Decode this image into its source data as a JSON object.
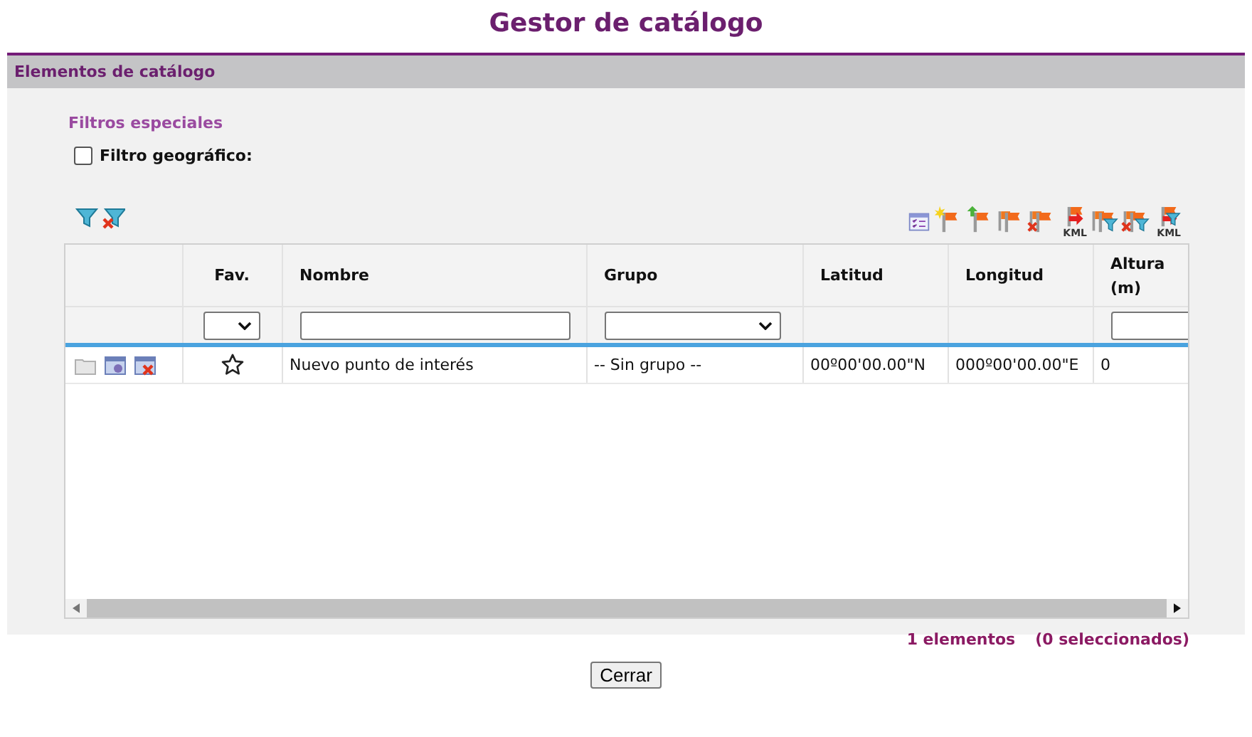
{
  "title": "Gestor de catálogo",
  "panel": {
    "title": "Elementos de catálogo"
  },
  "special_filters": {
    "title": "Filtros especiales",
    "geo_filter": {
      "label": "Filtro geográfico:",
      "checked": false
    }
  },
  "filter_tools": [
    {
      "kind": "filter"
    },
    {
      "kind": "filter-clear"
    }
  ],
  "toolbar": [
    {
      "kind": "checklist"
    },
    {
      "kind": "flag-new"
    },
    {
      "kind": "flag-arrow"
    },
    {
      "kind": "flags"
    },
    {
      "kind": "flags-delete"
    },
    {
      "kind": "flag-kml",
      "label": "KML"
    },
    {
      "kind": "flags-filter"
    },
    {
      "kind": "flags-delete-filter"
    },
    {
      "kind": "flag-kml-filter",
      "label": "KML"
    }
  ],
  "table": {
    "columns": [
      {
        "kind": "none"
      },
      {
        "label": "Fav.",
        "kind": "select"
      },
      {
        "label": "Nombre",
        "kind": "text"
      },
      {
        "label": "Grupo",
        "kind": "select"
      },
      {
        "label": "Latitud",
        "kind": "none"
      },
      {
        "label": "Longitud",
        "kind": "none"
      },
      {
        "label": "Altura (m)",
        "kind": "text"
      }
    ],
    "rows": [
      {
        "favorite": false,
        "name": "Nuevo punto de interés",
        "group": "-- Sin grupo --",
        "latitude": "00º00'00.00\"N",
        "longitude": "000º00'00.00\"E",
        "altitude": "0"
      }
    ]
  },
  "footer": {
    "count": "1 elementos",
    "selected": "(0 seleccionados)"
  },
  "buttons": [
    "Cerrar"
  ]
}
